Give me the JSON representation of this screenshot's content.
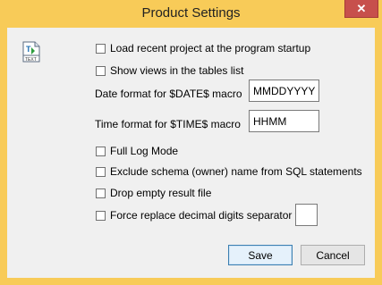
{
  "window": {
    "title": "Product Settings",
    "close_glyph": "✕"
  },
  "icon": {
    "name": "text-file-icon",
    "label": "TEXT"
  },
  "options": {
    "load_recent": "Load recent project at the program startup",
    "show_views": "Show views in the tables list",
    "full_log": "Full Log Mode",
    "exclude_schema": "Exclude schema (owner) name from SQL statements",
    "drop_empty": "Drop empty result file",
    "force_replace": "Force replace decimal digits separator to"
  },
  "fields": {
    "date_label": "Date format for $DATE$ macro",
    "date_value": "MMDDYYYY",
    "time_label": "Time format for $TIME$ macro",
    "time_value": "HHMM",
    "separator_value": ""
  },
  "buttons": {
    "save": "Save",
    "cancel": "Cancel"
  },
  "colors": {
    "frame": "#f8cb58",
    "close": "#c7504c",
    "client": "#f0f0f0"
  }
}
